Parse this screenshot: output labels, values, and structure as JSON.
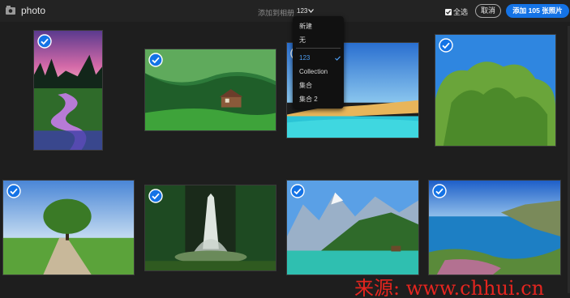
{
  "header": {
    "app_title": "photo",
    "add_to_label": "添加到相册",
    "album_selected": "123",
    "select_all_label": "全选",
    "cancel_label": "取消",
    "add_button_label": "添加 105 张照片"
  },
  "album_menu": {
    "items": [
      "新建",
      "无",
      "123",
      "Collection",
      "集合",
      "集合 2"
    ],
    "selected": "123"
  },
  "photos": [
    {
      "subject": "lake at sunset with purple sky",
      "selected": true
    },
    {
      "subject": "green forest with cabin",
      "selected": true
    },
    {
      "subject": "tropical beach",
      "selected": true
    },
    {
      "subject": "green tree under blue sky",
      "selected": true
    },
    {
      "subject": "tree in field with path",
      "selected": true
    },
    {
      "subject": "fountain in dark garden",
      "selected": true
    },
    {
      "subject": "mountain lake with boathouse",
      "selected": true
    },
    {
      "subject": "coastal cliffs and sea",
      "selected": true
    }
  ],
  "watermark": "来源: www.chhui.cn",
  "colors": {
    "accent": "#1473e6",
    "background": "#1e1e1e"
  }
}
